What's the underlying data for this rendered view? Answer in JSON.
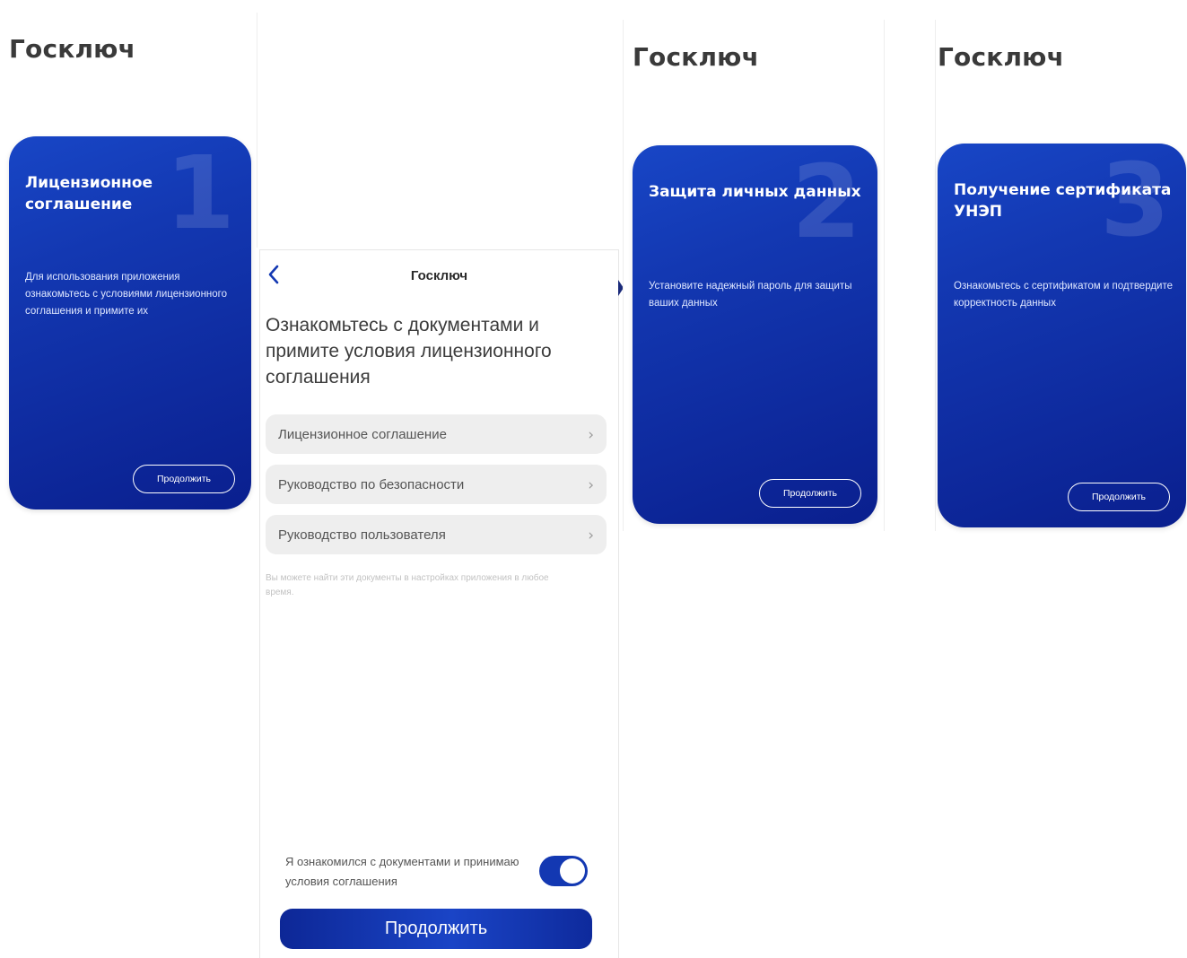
{
  "app_title": "Госключ",
  "colors": {
    "brand_blue": "#1338b2",
    "brand_blue_dark": "#0a1f8e",
    "gray_item": "#eeeeee"
  },
  "screens": [
    {
      "title": "Госключ",
      "number": "1",
      "card_title": "Лицензионное соглашение",
      "card_text": "Для использования приложения ознакомьтесь с условиями лицензионного соглашения и примите их",
      "button_label": "Продолжить"
    },
    {
      "title": "Госключ",
      "number": "2",
      "card_title": "Защита личных данных",
      "card_text": "Установите надежный пароль для защиты ваших данных",
      "button_label": "Продолжить"
    },
    {
      "title": "Госключ",
      "number": "3",
      "card_title": "Получение сертификата УНЭП",
      "card_text": "Ознакомьтесь с сертификатом и подтвердите корректность данных",
      "button_label": "Продолжить"
    }
  ],
  "documents_screen": {
    "nav_title": "Госключ",
    "back_icon": "chevron-left-icon",
    "heading": "Ознакомьтесь с документами и примите условия лицензионного соглашения",
    "documents": [
      {
        "label": "Лицензионное соглашение",
        "icon": "chevron-right-icon",
        "chevron": "›"
      },
      {
        "label": "Руководство по безопасности",
        "icon": "chevron-right-icon",
        "chevron": "›"
      },
      {
        "label": "Руководство пользователя",
        "icon": "chevron-right-icon",
        "chevron": "›"
      }
    ],
    "hint": "Вы можете найти эти документы в настройках приложения в любое время.",
    "accept_text": "Я ознакомился с документами и принимаю условия соглашения",
    "toggle_on": true,
    "continue_label": "Продолжить"
  }
}
